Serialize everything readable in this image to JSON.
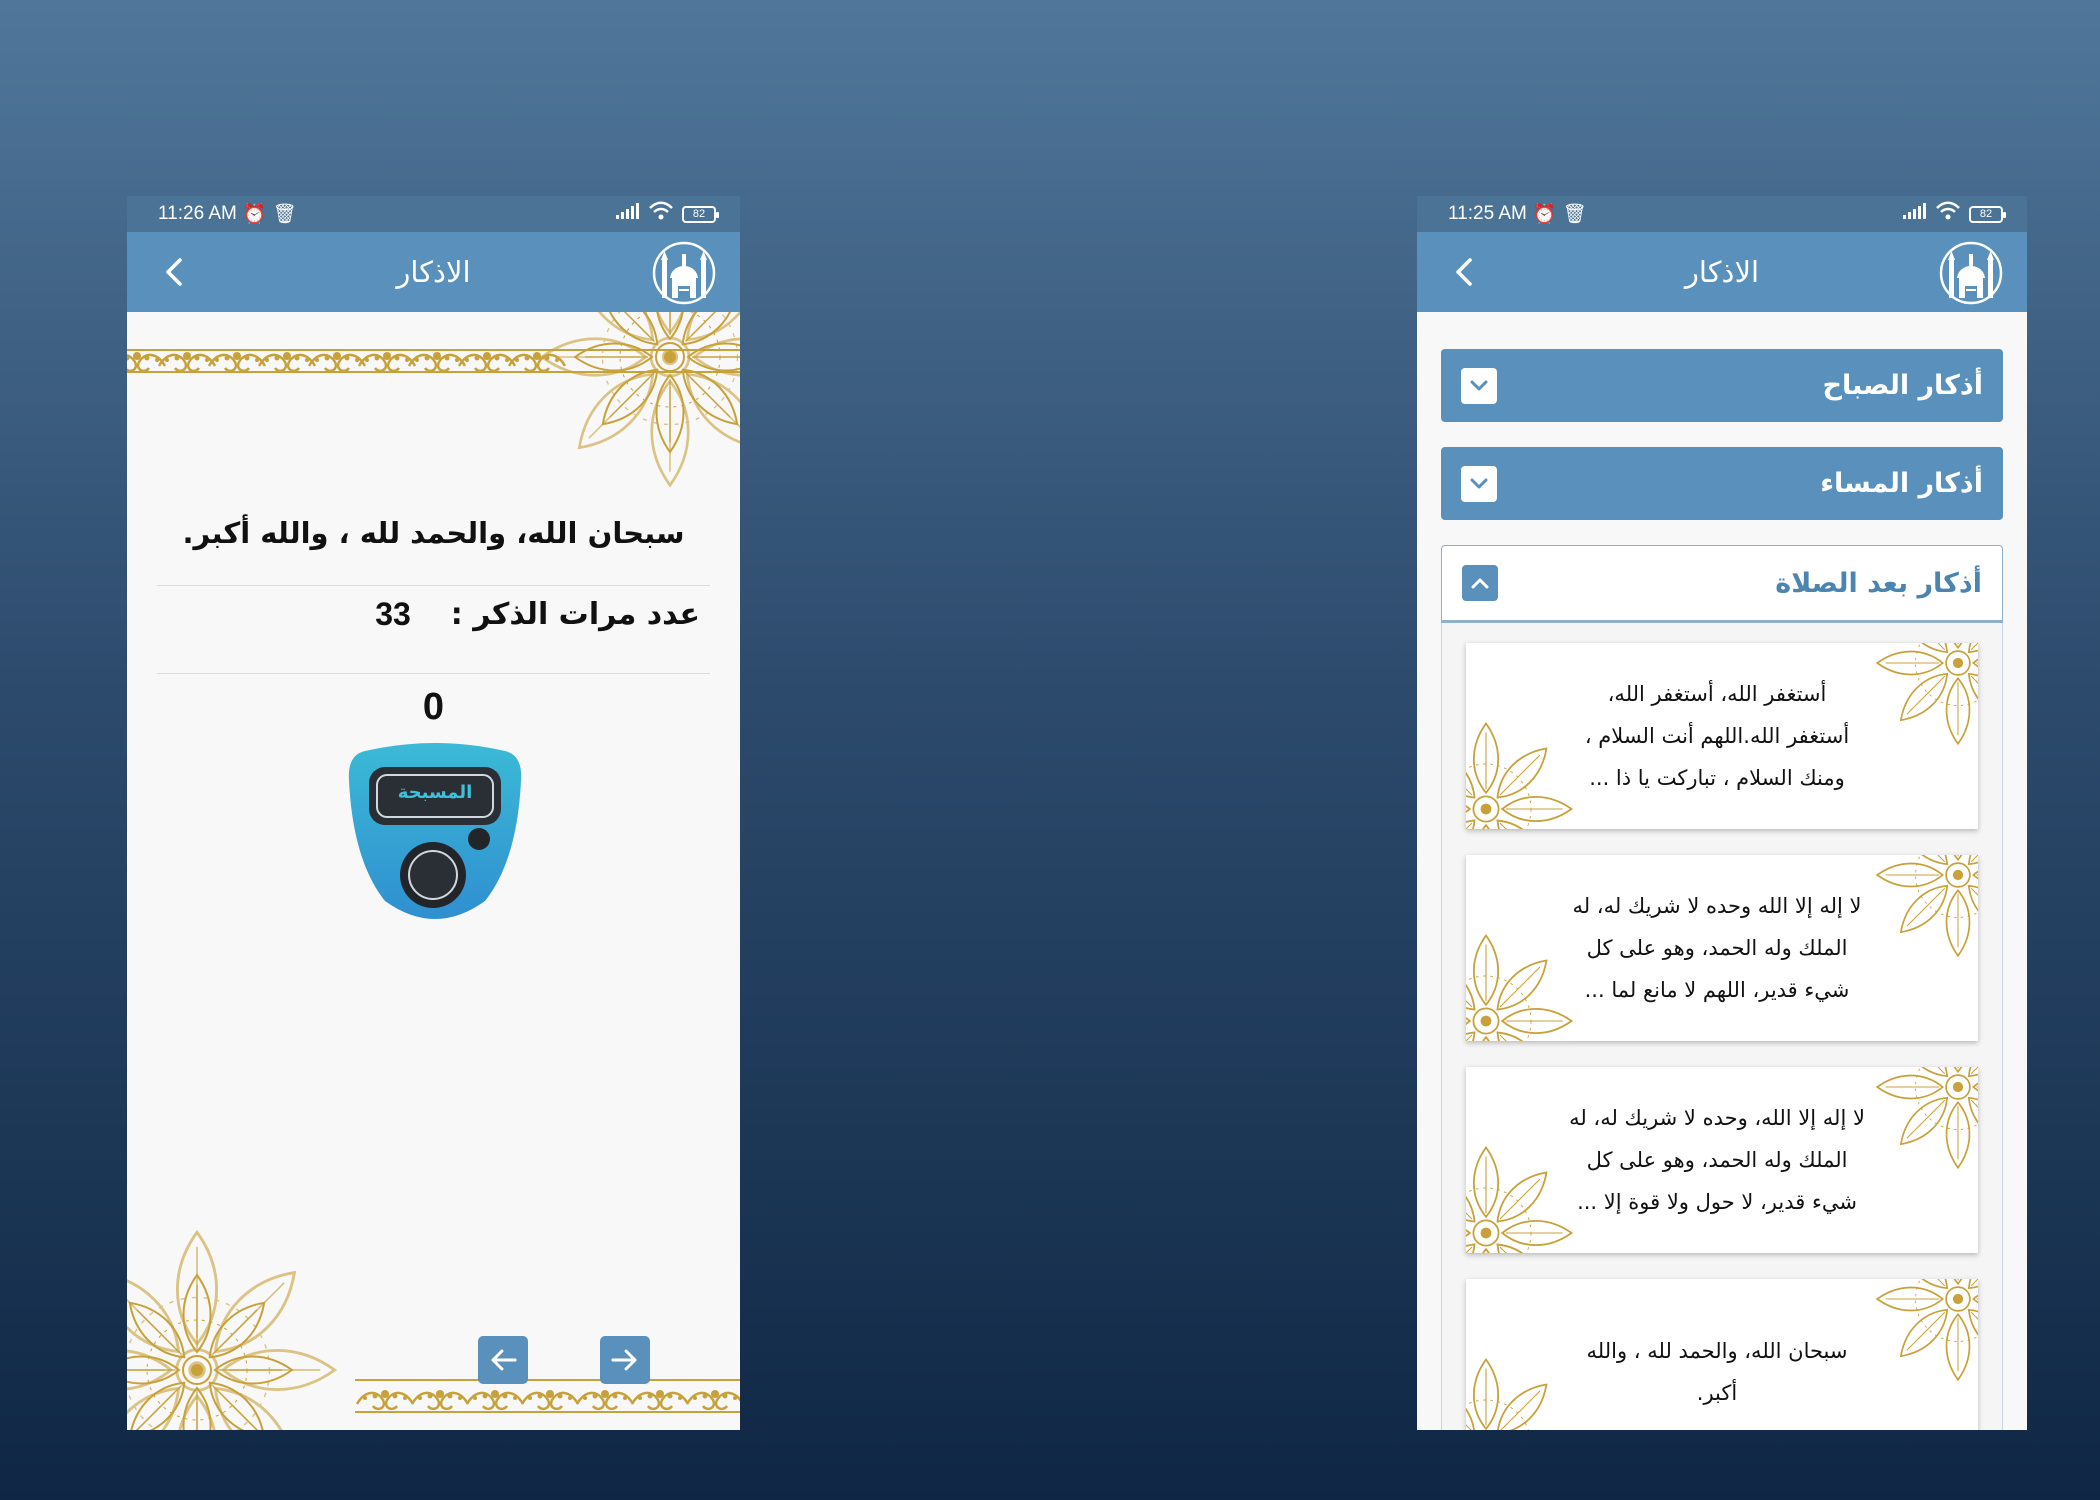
{
  "left_phone": {
    "status": {
      "time": "11:26 AM",
      "battery": "82"
    },
    "title": "الاذكار",
    "dhikr_text": "سبحان الله، والحمد لله ، والله أكبر.",
    "count_label": "عدد مرات الذكر :",
    "count_value": "33",
    "counter": "0",
    "tasbeeh_label": "المسبحة"
  },
  "right_phone": {
    "status": {
      "time": "11:25 AM",
      "battery": "82"
    },
    "title": "الاذكار",
    "sections": [
      {
        "title": "أذكار الصباح",
        "expanded": false
      },
      {
        "title": "أذكار المساء",
        "expanded": false
      },
      {
        "title": "أذكار بعد الصلاة",
        "expanded": true
      }
    ],
    "cards": [
      {
        "lines": [
          "أستغفر الله،  أستغفر الله،",
          "أستغفر الله.اللهم أنت السلام ،",
          "ومنك السلام ، تباركت يا ذا ..."
        ]
      },
      {
        "lines": [
          "لا إله إلا الله وحده لا شريك له، له",
          "الملك وله الحمد، وهو على كل",
          "شيء قدير، اللهم لا مانع لما ..."
        ]
      },
      {
        "lines": [
          "لا إله إلا الله، وحده لا شريك له، له",
          "الملك وله الحمد، وهو على كل",
          "شيء قدير، لا حول ولا قوة إلا ..."
        ]
      },
      {
        "lines": [
          "سبحان الله، والحمد لله ، والله",
          "أكبر."
        ]
      }
    ]
  },
  "colors": {
    "app_bar": "#5a91bc",
    "status_bar": "#4b7396",
    "ornament_gold": "#c9a13a"
  }
}
